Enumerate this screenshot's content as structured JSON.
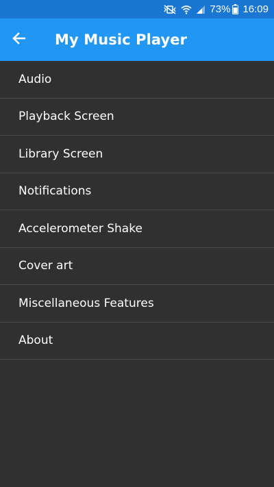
{
  "status_bar": {
    "battery_percent": "73%",
    "time": "16:09",
    "icons": [
      "mute-vibrate-icon",
      "wifi-icon",
      "signal-icon",
      "battery-icon"
    ]
  },
  "app_bar": {
    "back_icon": "arrow-left-icon",
    "title": "My Music Player",
    "color": "#2196F3",
    "status_color": "#1976D2"
  },
  "menu": {
    "items": [
      {
        "label": "Audio"
      },
      {
        "label": "Playback Screen"
      },
      {
        "label": "Library Screen"
      },
      {
        "label": "Notifications"
      },
      {
        "label": "Accelerometer Shake"
      },
      {
        "label": "Cover art"
      },
      {
        "label": "Miscellaneous Features"
      },
      {
        "label": "About"
      }
    ]
  },
  "theme": {
    "background": "#303030",
    "divider": "#4a4a4a",
    "text": "#ffffff"
  }
}
